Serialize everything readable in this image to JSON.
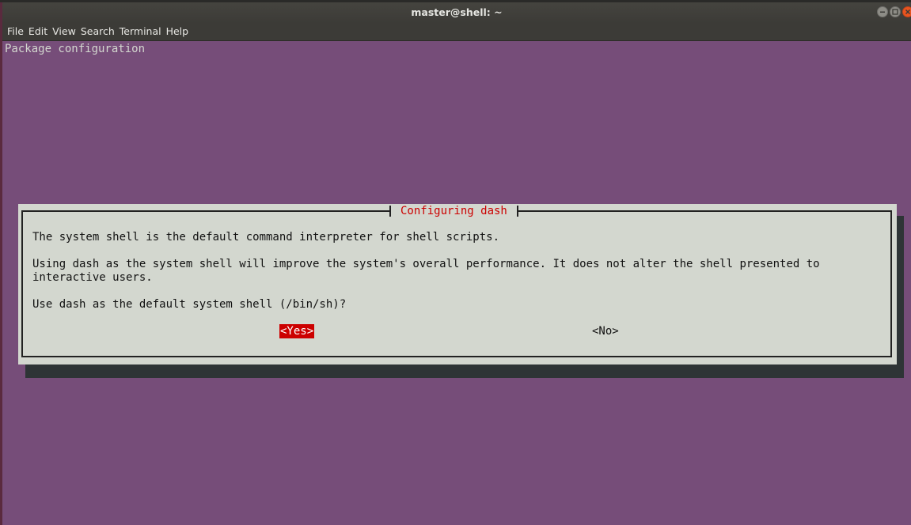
{
  "window": {
    "title": "master@shell: ~"
  },
  "menubar": {
    "items": [
      "File",
      "Edit",
      "View",
      "Search",
      "Terminal",
      "Help"
    ]
  },
  "terminal": {
    "screen_title": "Package configuration",
    "dialog": {
      "title": "Configuring dash",
      "line1": "The system shell is the default command interpreter for shell scripts.",
      "line2": "Using dash as the system shell will improve the system's overall performance. It does not alter the shell presented to",
      "line3": "interactive users.",
      "question": "Use dash as the default system shell (/bin/sh)?",
      "yes_label": "<Yes>",
      "no_label": "<No>"
    }
  },
  "colors": {
    "terminal_bg": "#764d79",
    "dialog_bg": "#d3d7cf",
    "accent_red": "#cc0000",
    "titlebar_bg": "#3c3b37",
    "close_button": "#e9541f"
  },
  "icons": {
    "minimize": "minimize-icon",
    "maximize": "maximize-icon",
    "close": "close-icon"
  }
}
